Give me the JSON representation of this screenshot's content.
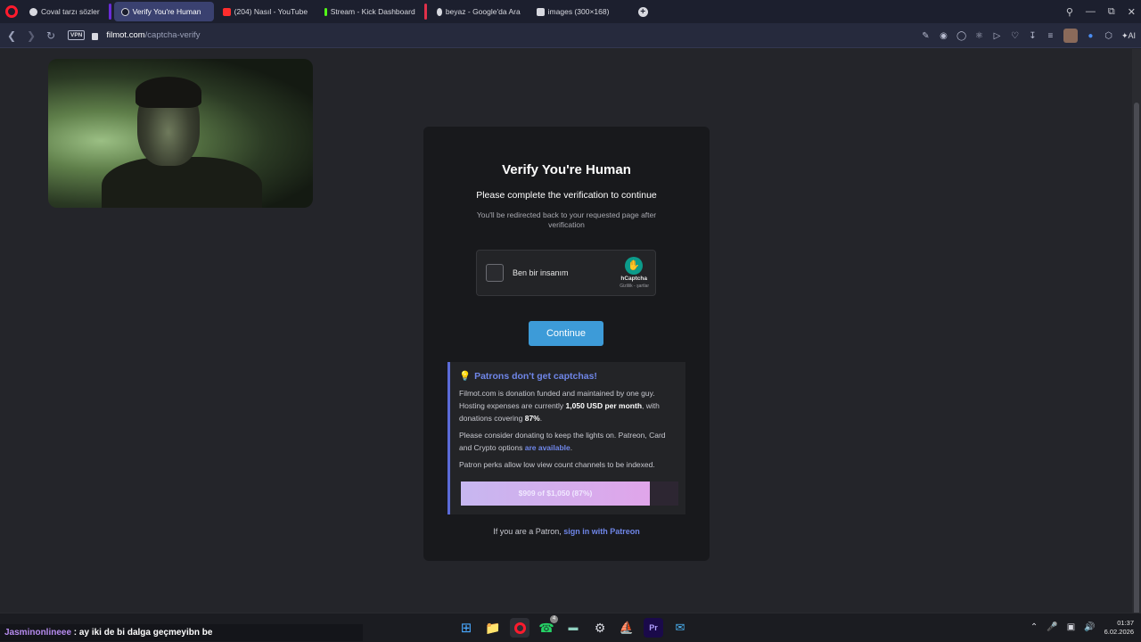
{
  "browser": {
    "tabs": [
      {
        "label": "Coval tarzı sözler",
        "active": false
      },
      {
        "label": "Verify You're Human",
        "active": true
      },
      {
        "label": "(204) Nasıl - YouTube",
        "active": false
      },
      {
        "label": "Stream - Kick Dashboard",
        "active": false
      },
      {
        "label": "beyaz - Google'da Ara",
        "active": false
      },
      {
        "label": "images (300×168)",
        "active": false
      }
    ],
    "vpn_label": "VPN",
    "url_host": "filmot.com",
    "url_path": "/captcha-verify",
    "ai_label": "AI"
  },
  "card": {
    "title": "Verify You're Human",
    "subtitle": "Please complete the verification to continue",
    "note": "You'll be redirected back to your requested page after verification",
    "captcha": {
      "label": "Ben bir insanım",
      "brand": "hCaptcha",
      "links": "Gizlilik - şartlar"
    },
    "continue_label": "Continue",
    "patron": {
      "title": "Patrons don't get captchas!",
      "p1_a": "Filmot.com is donation funded and maintained by one guy. Hosting expenses are currently ",
      "p1_amount": "1,050 USD per month",
      "p1_b": ", with donations covering ",
      "p1_pct": "87%",
      "p1_c": ".",
      "p2_a": "Please consider donating to keep the lights on. Patreon, Card and Crypto options ",
      "p2_link": "are available",
      "p2_c": ".",
      "p3": "Patron perks allow low view count channels to be indexed.",
      "progress_text": "$909 of $1,050 (87%)",
      "progress_fraction": 0.87
    },
    "signin_prefix": "If you are a Patron, ",
    "signin_link": "sign in with Patreon"
  },
  "overlay": {
    "chat_user": "Jasminonlineee",
    "chat_message": " : ay iki de bi dalga geçmeyibn be"
  },
  "taskbar": {
    "time": "01:37",
    "date": "6.02.2026",
    "whatsapp_badge": "4"
  },
  "colors": {
    "accent": "#3d9bd8",
    "link": "#6f86e8",
    "opera_red": "#ff1b2d"
  }
}
